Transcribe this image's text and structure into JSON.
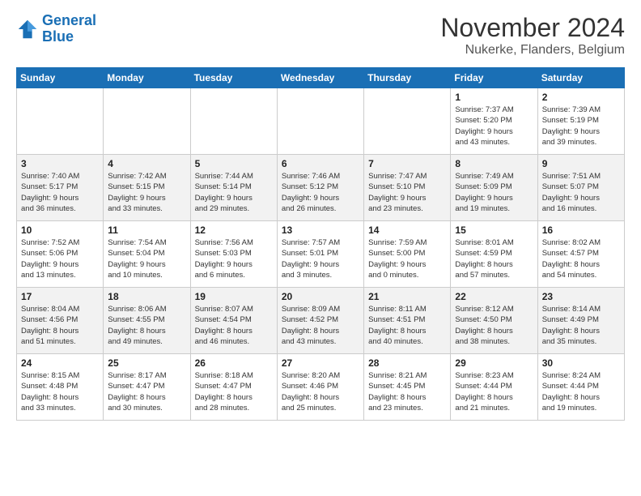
{
  "header": {
    "logo_line1": "General",
    "logo_line2": "Blue",
    "month_year": "November 2024",
    "location": "Nukerke, Flanders, Belgium"
  },
  "days_of_week": [
    "Sunday",
    "Monday",
    "Tuesday",
    "Wednesday",
    "Thursday",
    "Friday",
    "Saturday"
  ],
  "weeks": [
    [
      {
        "day": "",
        "detail": ""
      },
      {
        "day": "",
        "detail": ""
      },
      {
        "day": "",
        "detail": ""
      },
      {
        "day": "",
        "detail": ""
      },
      {
        "day": "",
        "detail": ""
      },
      {
        "day": "1",
        "detail": "Sunrise: 7:37 AM\nSunset: 5:20 PM\nDaylight: 9 hours\nand 43 minutes."
      },
      {
        "day": "2",
        "detail": "Sunrise: 7:39 AM\nSunset: 5:19 PM\nDaylight: 9 hours\nand 39 minutes."
      }
    ],
    [
      {
        "day": "3",
        "detail": "Sunrise: 7:40 AM\nSunset: 5:17 PM\nDaylight: 9 hours\nand 36 minutes."
      },
      {
        "day": "4",
        "detail": "Sunrise: 7:42 AM\nSunset: 5:15 PM\nDaylight: 9 hours\nand 33 minutes."
      },
      {
        "day": "5",
        "detail": "Sunrise: 7:44 AM\nSunset: 5:14 PM\nDaylight: 9 hours\nand 29 minutes."
      },
      {
        "day": "6",
        "detail": "Sunrise: 7:46 AM\nSunset: 5:12 PM\nDaylight: 9 hours\nand 26 minutes."
      },
      {
        "day": "7",
        "detail": "Sunrise: 7:47 AM\nSunset: 5:10 PM\nDaylight: 9 hours\nand 23 minutes."
      },
      {
        "day": "8",
        "detail": "Sunrise: 7:49 AM\nSunset: 5:09 PM\nDaylight: 9 hours\nand 19 minutes."
      },
      {
        "day": "9",
        "detail": "Sunrise: 7:51 AM\nSunset: 5:07 PM\nDaylight: 9 hours\nand 16 minutes."
      }
    ],
    [
      {
        "day": "10",
        "detail": "Sunrise: 7:52 AM\nSunset: 5:06 PM\nDaylight: 9 hours\nand 13 minutes."
      },
      {
        "day": "11",
        "detail": "Sunrise: 7:54 AM\nSunset: 5:04 PM\nDaylight: 9 hours\nand 10 minutes."
      },
      {
        "day": "12",
        "detail": "Sunrise: 7:56 AM\nSunset: 5:03 PM\nDaylight: 9 hours\nand 6 minutes."
      },
      {
        "day": "13",
        "detail": "Sunrise: 7:57 AM\nSunset: 5:01 PM\nDaylight: 9 hours\nand 3 minutes."
      },
      {
        "day": "14",
        "detail": "Sunrise: 7:59 AM\nSunset: 5:00 PM\nDaylight: 9 hours\nand 0 minutes."
      },
      {
        "day": "15",
        "detail": "Sunrise: 8:01 AM\nSunset: 4:59 PM\nDaylight: 8 hours\nand 57 minutes."
      },
      {
        "day": "16",
        "detail": "Sunrise: 8:02 AM\nSunset: 4:57 PM\nDaylight: 8 hours\nand 54 minutes."
      }
    ],
    [
      {
        "day": "17",
        "detail": "Sunrise: 8:04 AM\nSunset: 4:56 PM\nDaylight: 8 hours\nand 51 minutes."
      },
      {
        "day": "18",
        "detail": "Sunrise: 8:06 AM\nSunset: 4:55 PM\nDaylight: 8 hours\nand 49 minutes."
      },
      {
        "day": "19",
        "detail": "Sunrise: 8:07 AM\nSunset: 4:54 PM\nDaylight: 8 hours\nand 46 minutes."
      },
      {
        "day": "20",
        "detail": "Sunrise: 8:09 AM\nSunset: 4:52 PM\nDaylight: 8 hours\nand 43 minutes."
      },
      {
        "day": "21",
        "detail": "Sunrise: 8:11 AM\nSunset: 4:51 PM\nDaylight: 8 hours\nand 40 minutes."
      },
      {
        "day": "22",
        "detail": "Sunrise: 8:12 AM\nSunset: 4:50 PM\nDaylight: 8 hours\nand 38 minutes."
      },
      {
        "day": "23",
        "detail": "Sunrise: 8:14 AM\nSunset: 4:49 PM\nDaylight: 8 hours\nand 35 minutes."
      }
    ],
    [
      {
        "day": "24",
        "detail": "Sunrise: 8:15 AM\nSunset: 4:48 PM\nDaylight: 8 hours\nand 33 minutes."
      },
      {
        "day": "25",
        "detail": "Sunrise: 8:17 AM\nSunset: 4:47 PM\nDaylight: 8 hours\nand 30 minutes."
      },
      {
        "day": "26",
        "detail": "Sunrise: 8:18 AM\nSunset: 4:47 PM\nDaylight: 8 hours\nand 28 minutes."
      },
      {
        "day": "27",
        "detail": "Sunrise: 8:20 AM\nSunset: 4:46 PM\nDaylight: 8 hours\nand 25 minutes."
      },
      {
        "day": "28",
        "detail": "Sunrise: 8:21 AM\nSunset: 4:45 PM\nDaylight: 8 hours\nand 23 minutes."
      },
      {
        "day": "29",
        "detail": "Sunrise: 8:23 AM\nSunset: 4:44 PM\nDaylight: 8 hours\nand 21 minutes."
      },
      {
        "day": "30",
        "detail": "Sunrise: 8:24 AM\nSunset: 4:44 PM\nDaylight: 8 hours\nand 19 minutes."
      }
    ]
  ]
}
